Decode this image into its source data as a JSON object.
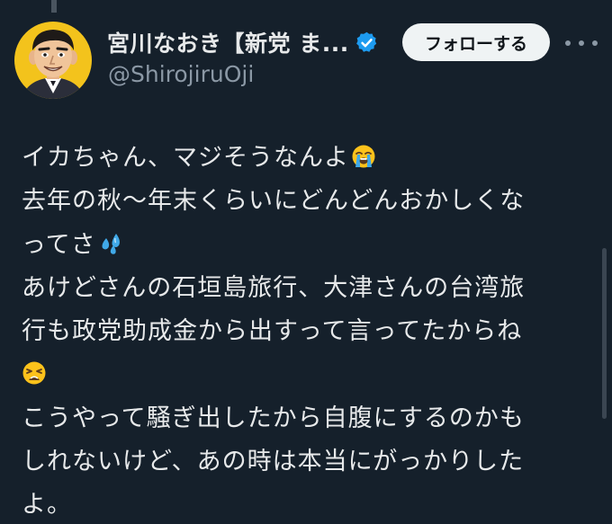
{
  "author": {
    "display_name": "宮川なおき【新党 ま...",
    "handle": "@ShirojiruOji",
    "verified": true,
    "avatar_icon": "caricature-avatar-icon"
  },
  "actions": {
    "follow_label": "フォローする",
    "more_icon": "more-options-icon"
  },
  "tweet": {
    "lines": [
      "イカちゃん、マジそうなんよ",
      "去年の秋〜年末くらいにどんどんおかしくな",
      "ってさ",
      "あけどさんの石垣島旅行、大津さんの台湾旅",
      "行も政党助成金から出すって言ってたからね",
      "",
      "こうやって騒ぎ出したから自腹にするのかも",
      "しれないけど、あの時は本当にがっかりした",
      "よ。"
    ],
    "emojis": [
      "loudly-crying-face",
      "sweat-droplets",
      "weary-face"
    ]
  },
  "colors": {
    "background": "#15202b",
    "text_primary": "#e7e9ea",
    "text_secondary": "#8b98a5",
    "verified_blue": "#1d9bf0",
    "follow_button_bg": "#eff3f4"
  }
}
